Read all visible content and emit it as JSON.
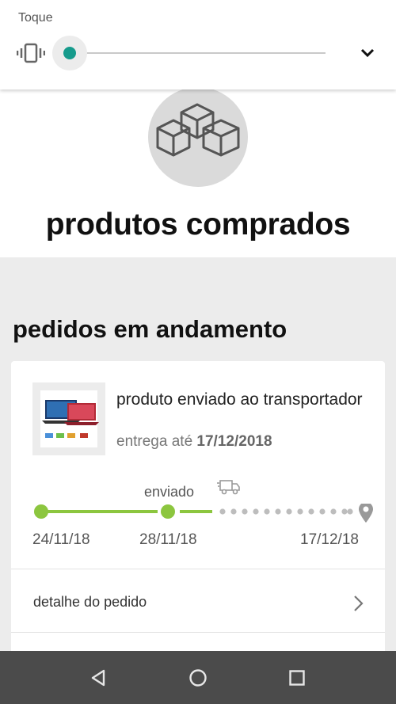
{
  "volume_panel": {
    "title": "Toque",
    "icon": "vibrate-icon",
    "level": 0.0,
    "accent_color": "#169b8c",
    "expand_icon": "chevron-down-icon"
  },
  "header": {
    "icon": "boxes-icon",
    "title": "produtos comprados"
  },
  "orders_section": {
    "title": "pedidos em andamento"
  },
  "order_card": {
    "status_text": "produto enviado ao transportador",
    "eta_prefix": "entrega até",
    "eta_date": "17/12/2018",
    "current_stage_label": "enviado",
    "progress_color": "#8cc63f",
    "timeline_dates": [
      "24/11/18",
      "28/11/18",
      "17/12/18"
    ],
    "detail_link": "detalhe do pedido"
  },
  "navbar": {
    "buttons": [
      "back-icon",
      "home-icon",
      "recents-icon"
    ],
    "background": "#4b4b4b"
  }
}
